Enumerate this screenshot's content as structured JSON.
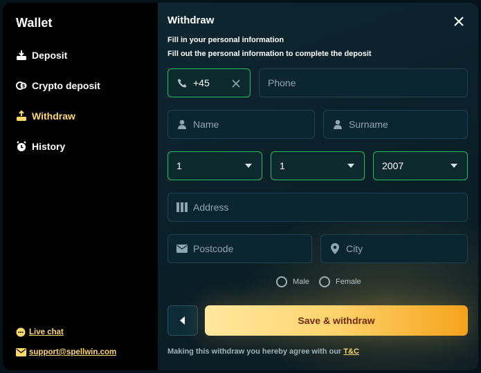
{
  "sidebar": {
    "title": "Wallet",
    "items": [
      {
        "label": "Deposit",
        "icon": "deposit-icon"
      },
      {
        "label": "Crypto deposit",
        "icon": "crypto-icon"
      },
      {
        "label": "Withdraw",
        "icon": "withdraw-icon",
        "active": true
      },
      {
        "label": "History",
        "icon": "clock-icon"
      }
    ],
    "live_chat": "Live chat",
    "support_email": "support@spellwin.com"
  },
  "form": {
    "heading": "Withdraw",
    "subtitle": "Fill in your personal information",
    "description": "Fill out the personal information to complete the deposit",
    "country_code": "+45",
    "phone_placeholder": "Phone",
    "name_placeholder": "Name",
    "surname_placeholder": "Surname",
    "dob_day": "1",
    "dob_month": "1",
    "dob_year": "2007",
    "address_placeholder": "Address",
    "postcode_placeholder": "Postcode",
    "city_placeholder": "City",
    "gender_male": "Male",
    "gender_female": "Female",
    "submit_label": "Save & withdraw",
    "terms_text": "Making this withdraw you hereby agree with our",
    "terms_link": "T&C"
  },
  "colors": {
    "accent": "#ffd86a",
    "valid_border": "#21c060",
    "cta_start": "#ffe8a0",
    "cta_end": "#f6a21c"
  }
}
